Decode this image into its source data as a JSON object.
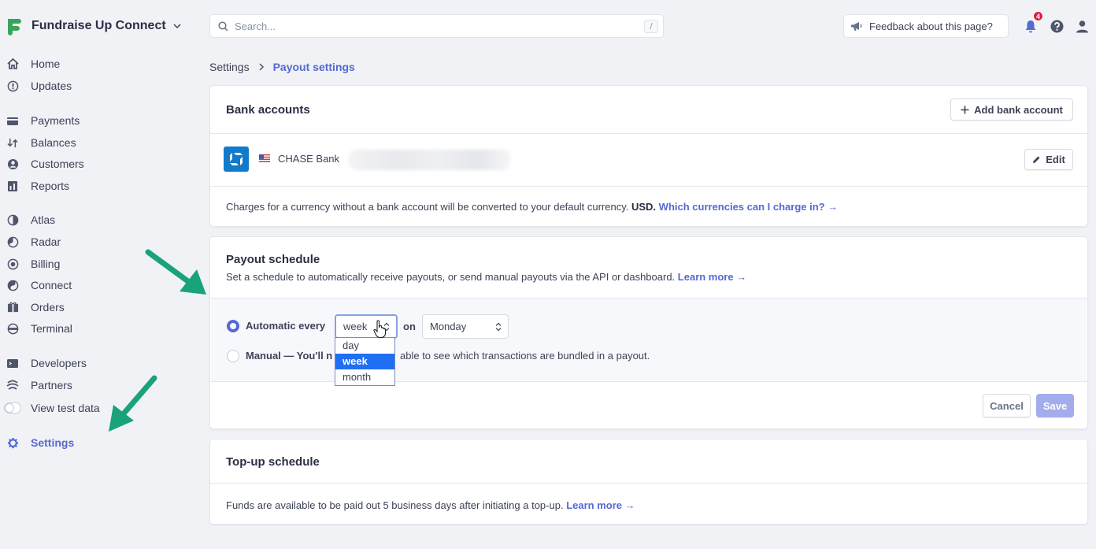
{
  "app": {
    "name": "Fundraise Up Connect",
    "logo_icon": "f-logo-icon",
    "brand_color": "#3aa55a"
  },
  "sidebar": {
    "items": [
      {
        "label": "Home",
        "icon": "home-icon"
      },
      {
        "label": "Updates",
        "icon": "updates-icon"
      },
      {
        "label": "Payments",
        "icon": "payments-icon"
      },
      {
        "label": "Balances",
        "icon": "balances-icon"
      },
      {
        "label": "Customers",
        "icon": "customers-icon"
      },
      {
        "label": "Reports",
        "icon": "reports-icon"
      },
      {
        "label": "Atlas",
        "icon": "atlas-icon"
      },
      {
        "label": "Radar",
        "icon": "radar-icon"
      },
      {
        "label": "Billing",
        "icon": "billing-icon"
      },
      {
        "label": "Connect",
        "icon": "connect-icon"
      },
      {
        "label": "Orders",
        "icon": "orders-icon"
      },
      {
        "label": "Terminal",
        "icon": "terminal-icon"
      },
      {
        "label": "Developers",
        "icon": "developers-icon"
      },
      {
        "label": "Partners",
        "icon": "partners-icon"
      },
      {
        "label": "View test data",
        "icon": "toggle-icon"
      },
      {
        "label": "Settings",
        "icon": "gear-icon",
        "active": true
      }
    ]
  },
  "topbar": {
    "search_placeholder": "Search...",
    "search_shortcut": "/",
    "feedback_label": "Feedback about this page?",
    "notification_count": "4"
  },
  "breadcrumb": {
    "parent": "Settings",
    "current": "Payout settings"
  },
  "bank_accounts": {
    "title": "Bank accounts",
    "add_button": "Add bank account",
    "bank_name": "CHASE Bank",
    "edit_button": "Edit",
    "note_prefix": "Charges for a currency without a bank account will be converted to your default currency.",
    "note_currency": "USD.",
    "note_link": "Which currencies can I charge in? →"
  },
  "payout_schedule": {
    "title": "Payout schedule",
    "description": "Set a schedule to automatically receive payouts, or send manual payouts via the API or dashboard.",
    "learn_more": "Learn more →",
    "automatic_label": "Automatic every",
    "interval_value": "week",
    "on_label": "on",
    "day_value": "Monday",
    "manual_label": "Manual — You'll n",
    "manual_rest": "able to see which transactions are bundled in a payout.",
    "interval_options": [
      "day",
      "week",
      "month"
    ],
    "selected_option": "week",
    "cancel_button": "Cancel",
    "save_button": "Save"
  },
  "topup_schedule": {
    "title": "Top-up schedule",
    "description": "Funds are available to be paid out 5 business days after initiating a top-up.",
    "learn_more": "Learn more →"
  },
  "colors": {
    "accent": "#5469d4",
    "save_disabled": "#a3acec",
    "annotation_arrow": "#1aa27a",
    "badge": "#df1b41"
  }
}
